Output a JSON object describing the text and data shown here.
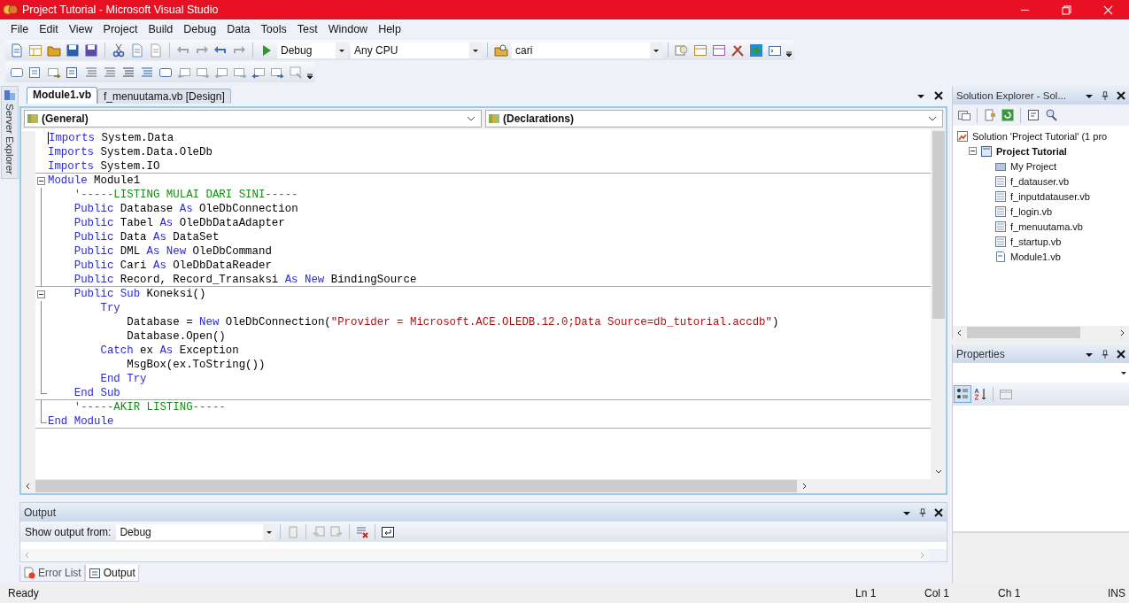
{
  "window": {
    "title": "Project Tutorial - Microsoft Visual Studio"
  },
  "menu": [
    "File",
    "Edit",
    "View",
    "Project",
    "Build",
    "Debug",
    "Data",
    "Tools",
    "Test",
    "Window",
    "Help"
  ],
  "toolbar": {
    "configuration": "Debug",
    "platform": "Any CPU",
    "find": "cari"
  },
  "side_tab": "Server Explorer",
  "editor": {
    "tabs": [
      {
        "label": "Module1.vb",
        "selected": true
      },
      {
        "label": "f_menuutama.vb [Design]",
        "selected": false
      }
    ],
    "class_dropdown": "(General)",
    "member_dropdown": "(Declarations)",
    "lines": [
      {
        "kind": "plain",
        "separator": false,
        "tokens": [
          {
            "kind": "kw",
            "text": "Imports"
          },
          {
            "kind": "plain",
            "text": " System.Data"
          }
        ]
      },
      {
        "kind": "plain",
        "separator": false,
        "tokens": [
          {
            "kind": "kw",
            "text": "Imports"
          },
          {
            "kind": "plain",
            "text": " System.Data.OleDb"
          }
        ]
      },
      {
        "kind": "plain",
        "separator": true,
        "tokens": [
          {
            "kind": "kw",
            "text": "Imports"
          },
          {
            "kind": "plain",
            "text": " System.IO"
          }
        ]
      },
      {
        "kind": "fold-start",
        "separator": false,
        "tokens": [
          {
            "kind": "kw",
            "text": "Module"
          },
          {
            "kind": "plain",
            "text": " Module1"
          }
        ]
      },
      {
        "kind": "fold-body",
        "separator": false,
        "tokens": [
          {
            "kind": "comment",
            "text": "    '-----LISTING MULAI DARI SINI-----"
          }
        ]
      },
      {
        "kind": "fold-body",
        "separator": false,
        "tokens": [
          {
            "kind": "kw",
            "text": "    Public"
          },
          {
            "kind": "plain",
            "text": " Database "
          },
          {
            "kind": "kw",
            "text": "As"
          },
          {
            "kind": "plain",
            "text": " OleDbConnection"
          }
        ]
      },
      {
        "kind": "fold-body",
        "separator": false,
        "tokens": [
          {
            "kind": "kw",
            "text": "    Public"
          },
          {
            "kind": "plain",
            "text": " Tabel "
          },
          {
            "kind": "kw",
            "text": "As"
          },
          {
            "kind": "plain",
            "text": " OleDbDataAdapter"
          }
        ]
      },
      {
        "kind": "fold-body",
        "separator": false,
        "tokens": [
          {
            "kind": "kw",
            "text": "    Public"
          },
          {
            "kind": "plain",
            "text": " Data "
          },
          {
            "kind": "kw",
            "text": "As"
          },
          {
            "kind": "plain",
            "text": " DataSet"
          }
        ]
      },
      {
        "kind": "fold-body",
        "separator": false,
        "tokens": [
          {
            "kind": "kw",
            "text": "    Public"
          },
          {
            "kind": "plain",
            "text": " DML "
          },
          {
            "kind": "kw",
            "text": "As New"
          },
          {
            "kind": "plain",
            "text": " OleDbCommand"
          }
        ]
      },
      {
        "kind": "fold-body",
        "separator": false,
        "tokens": [
          {
            "kind": "kw",
            "text": "    Public"
          },
          {
            "kind": "plain",
            "text": " Cari "
          },
          {
            "kind": "kw",
            "text": "As"
          },
          {
            "kind": "plain",
            "text": " OleDbDataReader"
          }
        ]
      },
      {
        "kind": "fold-body",
        "separator": true,
        "tokens": [
          {
            "kind": "kw",
            "text": "    Public"
          },
          {
            "kind": "plain",
            "text": " Record, Record_Transaksi "
          },
          {
            "kind": "kw",
            "text": "As New"
          },
          {
            "kind": "plain",
            "text": " BindingSource"
          }
        ]
      },
      {
        "kind": "fold-start",
        "separator": false,
        "tokens": [
          {
            "kind": "kw",
            "text": "    Public Sub"
          },
          {
            "kind": "plain",
            "text": " Koneksi()"
          }
        ]
      },
      {
        "kind": "fold-body",
        "separator": false,
        "tokens": [
          {
            "kind": "kw",
            "text": "        Try"
          }
        ]
      },
      {
        "kind": "fold-body",
        "separator": false,
        "tokens": [
          {
            "kind": "plain",
            "text": "            Database = "
          },
          {
            "kind": "kw",
            "text": "New"
          },
          {
            "kind": "plain",
            "text": " OleDbConnection("
          },
          {
            "kind": "str",
            "text": "\"Provider = Microsoft.ACE.OLEDB.12.0;Data Source=db_tutorial.accdb\""
          },
          {
            "kind": "plain",
            "text": ")"
          }
        ]
      },
      {
        "kind": "fold-body",
        "separator": false,
        "tokens": [
          {
            "kind": "plain",
            "text": "            Database.Open()"
          }
        ]
      },
      {
        "kind": "fold-body",
        "separator": false,
        "tokens": [
          {
            "kind": "kw",
            "text": "        Catch"
          },
          {
            "kind": "plain",
            "text": " ex "
          },
          {
            "kind": "kw",
            "text": "As"
          },
          {
            "kind": "plain",
            "text": " Exception"
          }
        ]
      },
      {
        "kind": "fold-body",
        "separator": false,
        "tokens": [
          {
            "kind": "plain",
            "text": "            MsgBox(ex.ToString())"
          }
        ]
      },
      {
        "kind": "fold-body",
        "separator": false,
        "tokens": [
          {
            "kind": "kw",
            "text": "        End Try"
          }
        ]
      },
      {
        "kind": "fold-end",
        "separator": true,
        "tokens": [
          {
            "kind": "kw",
            "text": "    End Sub"
          }
        ]
      },
      {
        "kind": "fold-body",
        "separator": false,
        "tokens": [
          {
            "kind": "comment",
            "text": "    '-----AKIR LISTING-----"
          }
        ]
      },
      {
        "kind": "fold-last",
        "separator": true,
        "tokens": [
          {
            "kind": "kw",
            "text": "End Module"
          }
        ]
      }
    ]
  },
  "output": {
    "title": "Output",
    "source_label": "Show output from:",
    "source": "Debug"
  },
  "bottom_tabs": [
    {
      "label": "Error List",
      "kind": "errors",
      "selected": false
    },
    {
      "label": "Output",
      "kind": "output",
      "selected": true
    }
  ],
  "solution_explorer": {
    "title": "Solution Explorer - Sol...",
    "tree": [
      {
        "label": "Solution 'Project Tutorial' (1 pro",
        "kind": "solution",
        "children": [
          {
            "label": "Project Tutorial",
            "kind": "project",
            "expanded": true,
            "children": [
              {
                "label": "My Project",
                "kind": "settings"
              },
              {
                "label": "f_datauser.vb",
                "kind": "form"
              },
              {
                "label": "f_inputdatauser.vb",
                "kind": "form"
              },
              {
                "label": "f_login.vb",
                "kind": "form"
              },
              {
                "label": "f_menuutama.vb",
                "kind": "form"
              },
              {
                "label": "f_startup.vb",
                "kind": "form"
              },
              {
                "label": "Module1.vb",
                "kind": "module"
              }
            ]
          }
        ]
      }
    ]
  },
  "properties": {
    "title": "Properties"
  },
  "status_bar": {
    "message": "Ready",
    "line": "Ln 1",
    "column": "Col 1",
    "char": "Ch 1",
    "mode": "INS"
  }
}
